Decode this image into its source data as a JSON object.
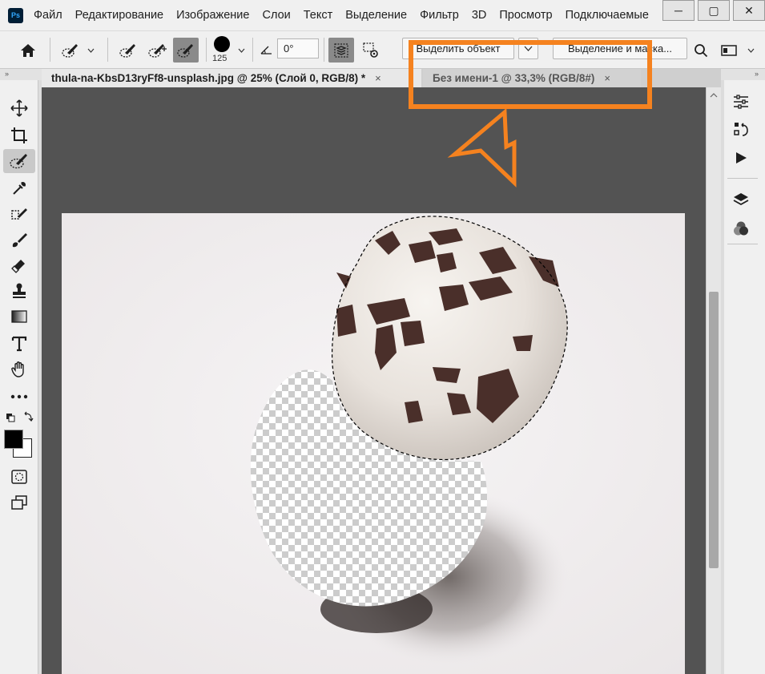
{
  "app": {
    "logo": "Ps",
    "menu": [
      "Файл",
      "Редактирование",
      "Изображение",
      "Слои",
      "Текст",
      "Выделение",
      "Фильтр",
      "3D",
      "Просмотр",
      "Подключаемые"
    ]
  },
  "window_controls": {
    "minimize": "─",
    "restore": "▢",
    "close": "✕"
  },
  "options": {
    "brush_size": "125",
    "angle_value": "0°",
    "select_subject_label": "Выделить объект",
    "select_mask_label": "Выделение и маска..."
  },
  "tabs": [
    {
      "label": "thula-na-KbsD13ryFf8-unsplash.jpg @ 25% (Слой 0, RGB/8) *",
      "close": "×"
    },
    {
      "label": "Без имени-1 @ 33,3% (RGB/8#)",
      "close": "×"
    }
  ],
  "panels_collapse": "»",
  "colors": {
    "annotation": "#f5821f",
    "foreground": "#000000",
    "background": "#ffffff",
    "canvas_backdrop": "#535353",
    "chrome": "#f0f0f0"
  },
  "icons": {
    "left_tools": [
      "move-icon",
      "crop-icon",
      "quick-select-icon",
      "eyedropper-icon",
      "spot-healing-icon",
      "brush-icon",
      "eraser-icon",
      "stamp-icon",
      "gradient-icon",
      "type-icon",
      "hand-icon",
      "more-icon"
    ],
    "right_panels": [
      "adjustments-icon",
      "history-icon",
      "actions-icon",
      "layers-icon",
      "channels-icon"
    ]
  }
}
